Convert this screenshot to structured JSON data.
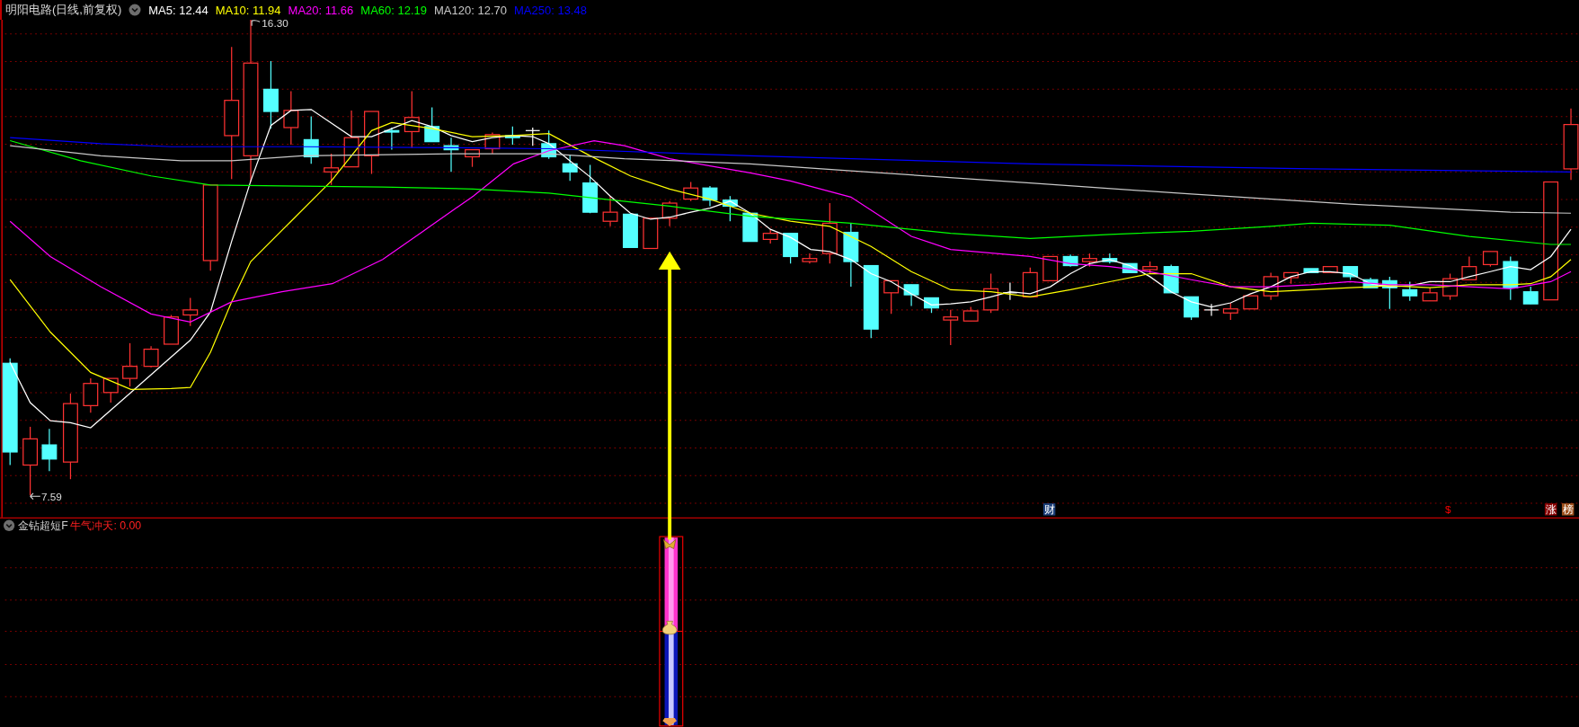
{
  "header": {
    "title": "明阳电路(日线,前复权)",
    "moving_averages": [
      {
        "label": "MA5: 12.44",
        "color": "#ffffff"
      },
      {
        "label": "MA10: 11.94",
        "color": "#ffff00"
      },
      {
        "label": "MA20: 11.66",
        "color": "#ff00ff"
      },
      {
        "label": "MA60: 12.19",
        "color": "#00ff00"
      },
      {
        "label": "MA120: 12.70",
        "color": "#c8c8c8"
      },
      {
        "label": "MA250: 13.48",
        "color": "#0000ff"
      }
    ]
  },
  "price_labels": {
    "high": "16.30",
    "low": "7.59"
  },
  "event_markers": [
    {
      "kind": "finance",
      "text": "财"
    },
    {
      "kind": "dollar",
      "text": "$"
    },
    {
      "kind": "limit_up",
      "text": "涨"
    },
    {
      "kind": "ranking",
      "text": "榜"
    }
  ],
  "indicator": {
    "name": "金钻超短F",
    "reading": "牛气冲天: 0.00"
  }
}
